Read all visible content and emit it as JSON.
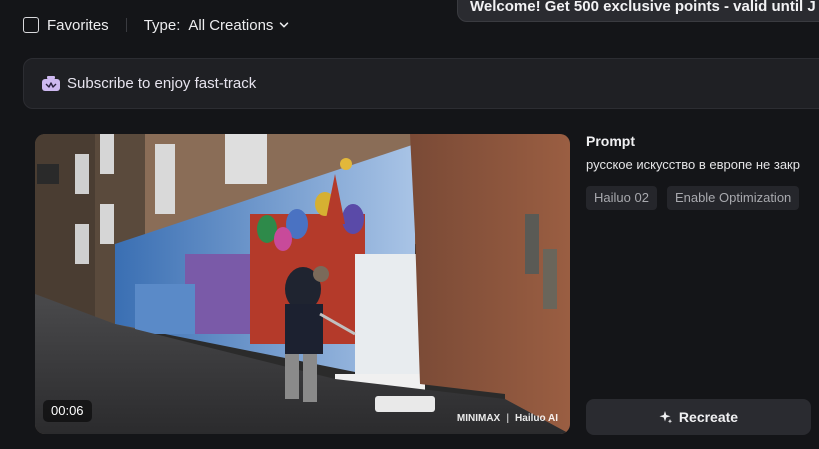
{
  "filters": {
    "favorites_label": "Favorites",
    "type_label": "Type:",
    "type_value": "All Creations"
  },
  "toast": {
    "text": "Welcome! Get 500 exclusive points - valid until J"
  },
  "subscribe": {
    "text": "Subscribe to enjoy fast-track"
  },
  "video": {
    "duration": "00:06",
    "watermark_brand": "MINIMAX",
    "watermark_product": "Hailuo AI"
  },
  "details": {
    "prompt_title": "Prompt",
    "prompt_text": "русское искусство в европе не закр",
    "tags": [
      "Hailuo 02",
      "Enable Optimization"
    ],
    "recreate_label": "Recreate"
  }
}
